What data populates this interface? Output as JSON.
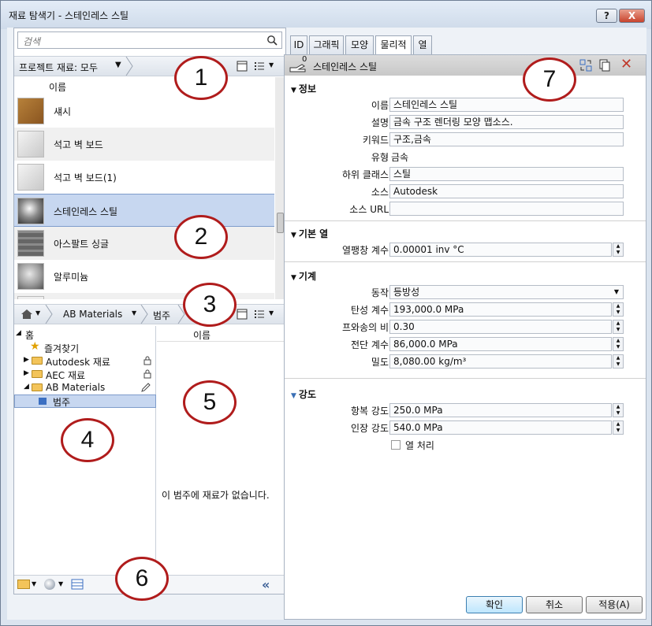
{
  "window": {
    "title": "재료 탐색기 - 스테인레스 스틸",
    "help_label": "?",
    "close_label": "X"
  },
  "library": {
    "search_placeholder": "검색",
    "filter_label": "프로젝트 재료: 모두",
    "list_header": "이름",
    "items": [
      {
        "label": "섀시",
        "thumb": "wood"
      },
      {
        "label": "석고 벽 보드",
        "thumb": "plaster"
      },
      {
        "label": "석고 벽 보드(1)",
        "thumb": "plaster"
      },
      {
        "label": "스테인레스 스틸",
        "thumb": "steel",
        "selected": true
      },
      {
        "label": "아스팔트 싱글",
        "thumb": "shingle"
      },
      {
        "label": "알루미늄",
        "thumb": "aluminum"
      }
    ]
  },
  "browser": {
    "breadcrumb": [
      "AB Materials",
      "범주"
    ],
    "tree": {
      "home": "홈",
      "favorites": "즐겨찾기",
      "autodesk": "Autodesk 재료",
      "aec": "AEC 재료",
      "ab": "AB Materials",
      "category": "범주"
    },
    "list_header": "이름",
    "empty_message": "이 범주에 재료가 없습니다."
  },
  "tabs": [
    "ID",
    "그래픽",
    "모양",
    "물리적",
    "열"
  ],
  "active_tab": "물리적",
  "asset": {
    "name": "스테인레스 스틸",
    "count": "0"
  },
  "sections": {
    "info": {
      "title": "정보",
      "name_label": "이름",
      "name_value": "스테인레스 스틸",
      "desc_label": "설명",
      "desc_value": "금속 구조 렌더링 모양 맵소스.",
      "keyword_label": "키워드",
      "keyword_value": "구조,금속",
      "type_label": "유형",
      "type_value": "금속",
      "subclass_label": "하위 클래스",
      "subclass_value": "스틸",
      "source_label": "소스",
      "source_value": "Autodesk",
      "url_label": "소스 URL",
      "url_value": ""
    },
    "thermal": {
      "title": "기본 열",
      "exp_label": "열팽창 계수",
      "exp_value": "0.00001 inv °C"
    },
    "mechanical": {
      "title": "기계",
      "behavior_label": "동작",
      "behavior_value": "등방성",
      "young_label": "탄성 계수",
      "young_value": "193,000.0 MPa",
      "poisson_label": "프와송의 비",
      "poisson_value": "0.30",
      "shear_label": "전단 계수",
      "shear_value": "86,000.0 MPa",
      "density_label": "밀도",
      "density_value": "8,080.00 kg/m³"
    },
    "strength": {
      "title": "강도",
      "yield_label": "항복 강도",
      "yield_value": "250.0 MPa",
      "tensile_label": "인장 강도",
      "tensile_value": "540.0 MPa",
      "heat_label": "열 처리"
    }
  },
  "buttons": {
    "ok": "확인",
    "cancel": "취소",
    "apply": "적용(A)"
  },
  "callouts": [
    "1",
    "2",
    "3",
    "4",
    "5",
    "6",
    "7"
  ]
}
